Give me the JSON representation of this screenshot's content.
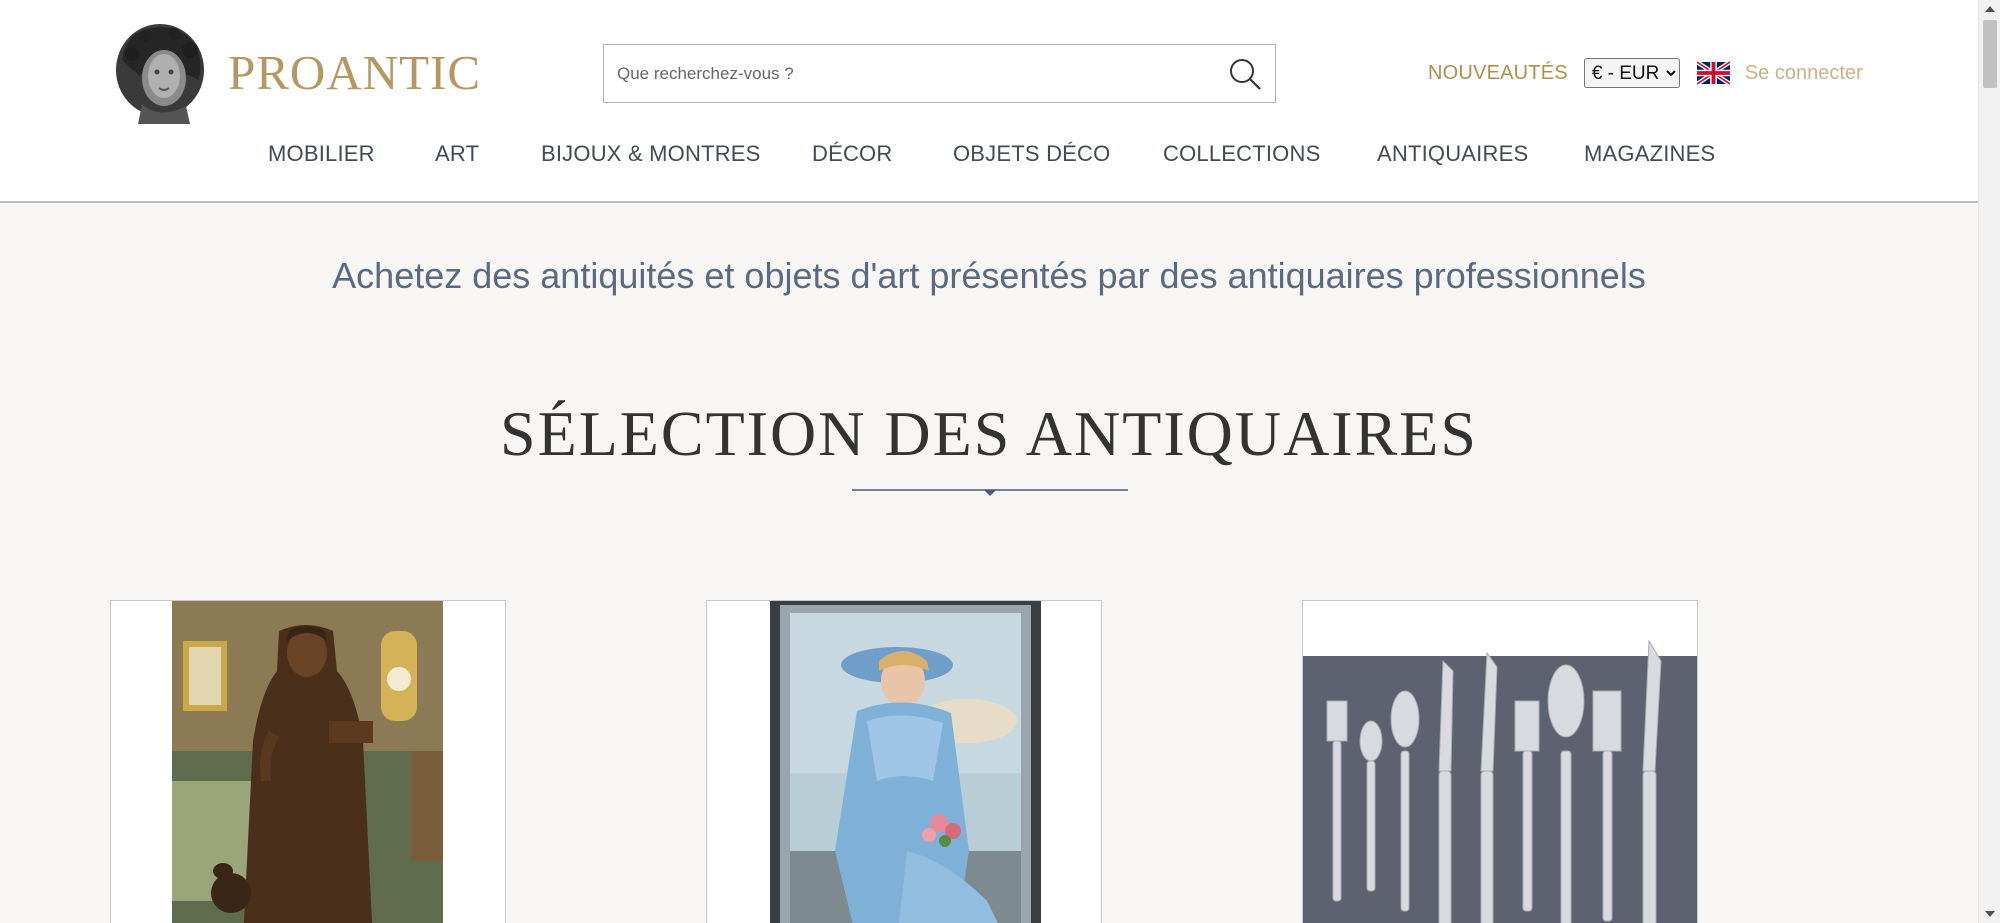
{
  "header": {
    "logo_text": "PROANTIC",
    "search_placeholder": "Que recherchez-vous ?",
    "nouveautes_label": "NOUVEAUTÉS",
    "currency_selected": "€ - EUR",
    "language_flag": "uk-flag-icon",
    "connect_label": "Se connecter"
  },
  "nav": {
    "items": [
      {
        "label": "MOBILIER"
      },
      {
        "label": "ART"
      },
      {
        "label": "BIJOUX & MONTRES"
      },
      {
        "label": "DÉCOR"
      },
      {
        "label": "OBJETS DÉCO"
      },
      {
        "label": "COLLECTIONS"
      },
      {
        "label": "ANTIQUAIRES"
      },
      {
        "label": "MAGAZINES"
      }
    ]
  },
  "main": {
    "tagline": "Achetez des antiquités et objets d'art présentés par des antiquaires professionnels",
    "section_title": "SÉLECTION DES ANTIQUAIRES"
  },
  "colors": {
    "gold": "#b59761",
    "gold_light": "#c9b388",
    "nav_text": "#444a52",
    "tagline": "#5a6a80",
    "background": "#f7f6f4",
    "divider": "#4a5a72"
  }
}
